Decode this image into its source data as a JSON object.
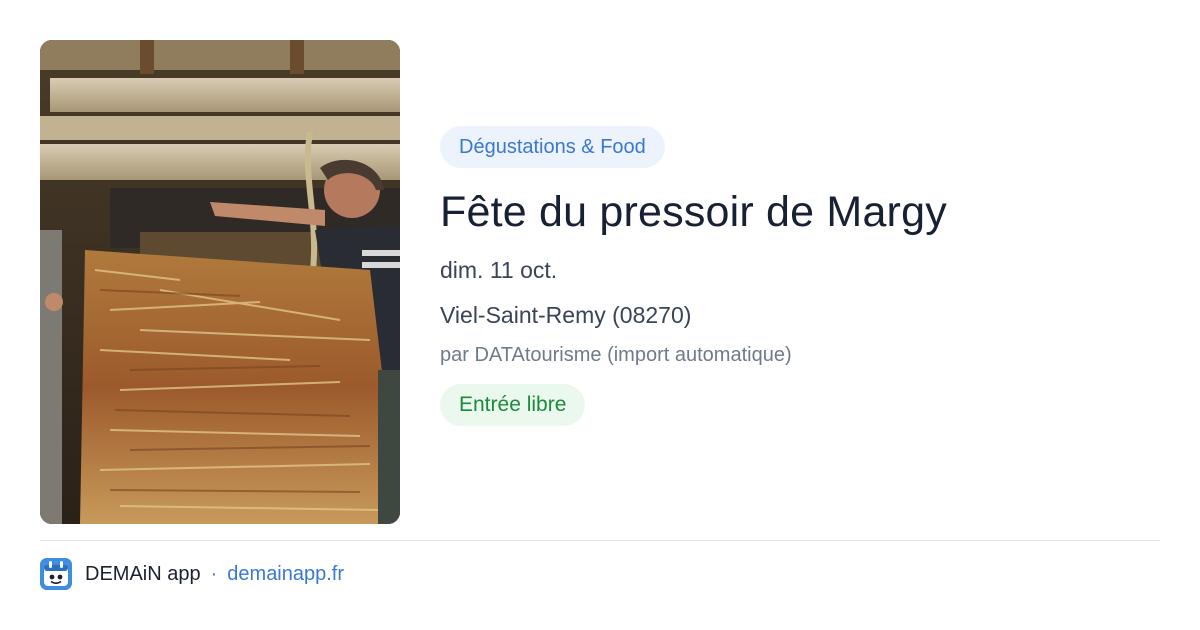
{
  "event": {
    "category": "Dégustations & Food",
    "title": "Fête du pressoir de Margy",
    "date": "dim. 11 oct.",
    "location": "Viel-Saint-Remy (08270)",
    "author": "par DATAtourisme (import automatique)",
    "price": "Entrée libre",
    "photo_icon": "traditional-apple-press-photo"
  },
  "footer": {
    "app_name": "DEMAiN app",
    "separator": "·",
    "link": "demainapp.fr",
    "icon": "demain-app-logo-icon"
  },
  "colors": {
    "accent": "#3a78d4",
    "category_bg": "#edf3fd",
    "price_text": "#1e8a3e",
    "price_bg": "#ebf8ee"
  }
}
